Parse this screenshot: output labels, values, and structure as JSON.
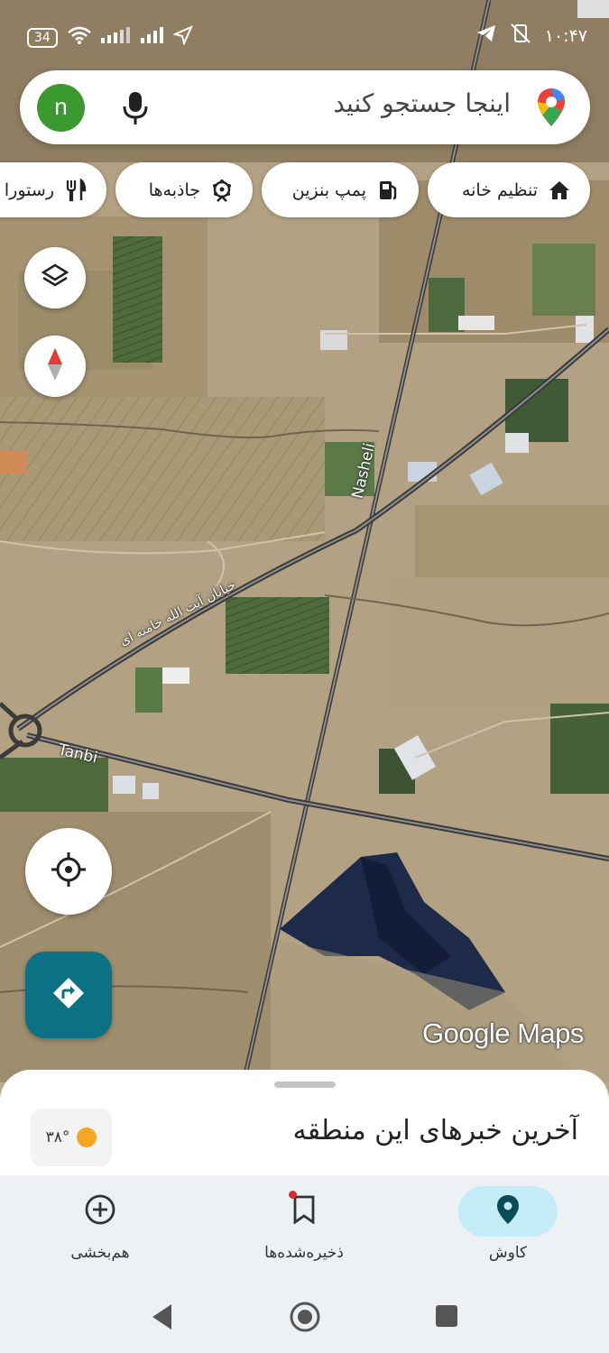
{
  "status_bar": {
    "battery": "34",
    "time": "۱۰:۴۷"
  },
  "search": {
    "avatar_letter": "n",
    "placeholder": "اینجا جستجو کنید"
  },
  "chips": [
    {
      "label": "تنظیم خانه",
      "icon": "home-icon"
    },
    {
      "label": "پمپ بنزین",
      "icon": "gas-station-icon"
    },
    {
      "label": "جاذبه‌ها",
      "icon": "attractions-icon"
    },
    {
      "label": "رستورا",
      "icon": "restaurant-icon"
    }
  ],
  "map": {
    "road_labels": {
      "nasheli": "Nasheli",
      "tanbi": "Tanbi",
      "khamenei": "خیابان آیت الله خامنه ای"
    },
    "watermark": "Google Maps"
  },
  "sheet": {
    "title": "آخرین خبرهای این منطقه",
    "weather": "۳۸°"
  },
  "nav": {
    "explore": "کاوش",
    "saved": "ذخیره‌شده‌ها",
    "contribute": "هم‌بخشی"
  },
  "colors": {
    "accent": "#0b7285",
    "explore_pill": "#c3ecf6",
    "avatar": "#3b9a2f"
  }
}
